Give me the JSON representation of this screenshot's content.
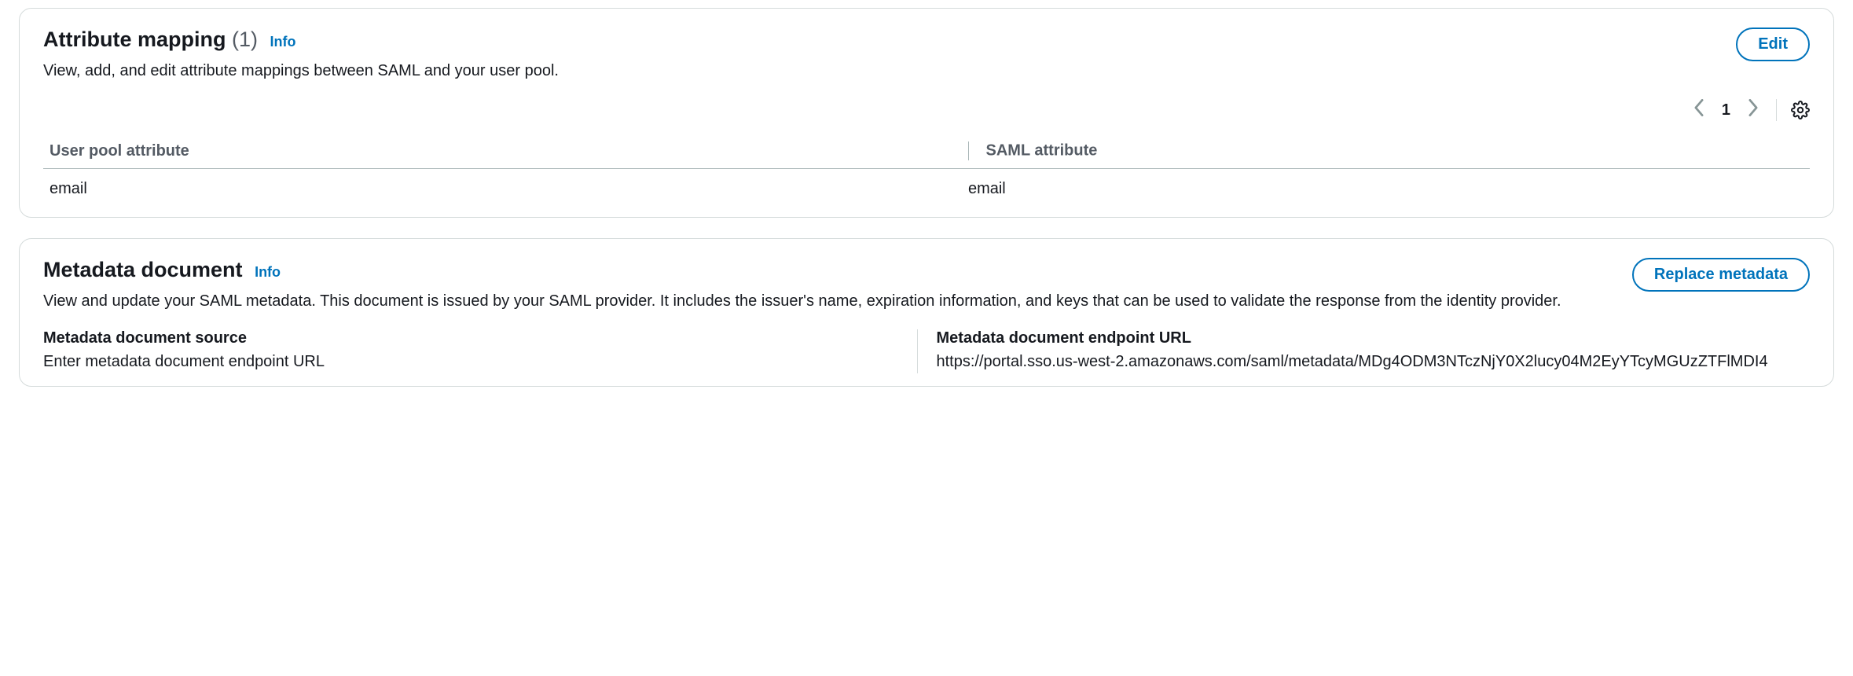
{
  "attribute_mapping": {
    "title": "Attribute mapping",
    "count": "(1)",
    "info": "Info",
    "description": "View, add, and edit attribute mappings between SAML and your user pool.",
    "edit_label": "Edit",
    "page": "1",
    "columns": {
      "user_pool": "User pool attribute",
      "saml": "SAML attribute"
    },
    "rows": [
      {
        "user_pool": "email",
        "saml": "email"
      }
    ]
  },
  "metadata": {
    "title": "Metadata document",
    "info": "Info",
    "description": "View and update your SAML metadata. This document is issued by your SAML provider. It includes the issuer's name, expiration information, and keys that can be used to validate the response from the identity provider.",
    "replace_label": "Replace metadata",
    "source_label": "Metadata document source",
    "source_value": "Enter metadata document endpoint URL",
    "endpoint_label": "Metadata document endpoint URL",
    "endpoint_value": "https://portal.sso.us-west-2.amazonaws.com/saml/metadata/MDg4ODM3NTczNjY0X2lucy04M2EyYTcyMGUzZTFlMDI4"
  }
}
